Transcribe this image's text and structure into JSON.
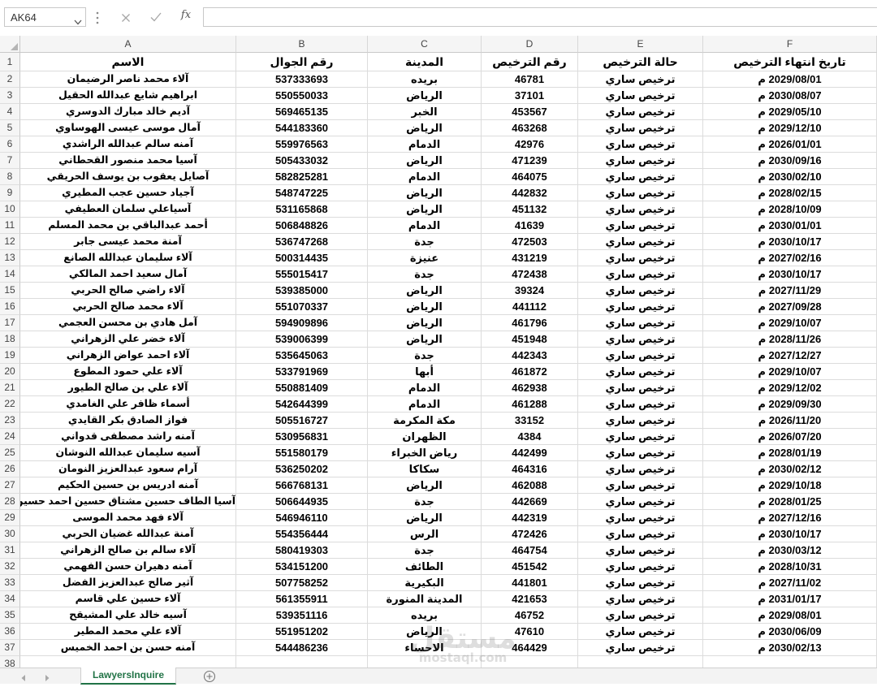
{
  "colors": {
    "accent": "#217346"
  },
  "name_box": {
    "value": "AK64",
    "dropdown_icon": "chevron-down-icon"
  },
  "formula_bar": {
    "grip_icon": "vertical-ellipsis-icon",
    "cancel_icon": "close-icon",
    "enter_icon": "check-icon",
    "function_label": "fx",
    "value": ""
  },
  "sheet": {
    "columns": [
      "A",
      "B",
      "C",
      "D",
      "E",
      "F"
    ],
    "row_numbers": [
      "1",
      "2",
      "3",
      "4",
      "5",
      "6",
      "7",
      "8",
      "9",
      "10",
      "11",
      "12",
      "13",
      "14",
      "15",
      "16",
      "17",
      "18",
      "19",
      "20",
      "21",
      "22",
      "23",
      "24",
      "25",
      "26",
      "27",
      "28",
      "29",
      "30",
      "31",
      "32",
      "33",
      "34",
      "35",
      "36",
      "37",
      "38"
    ],
    "rows": [
      [
        "الاسم",
        "رقم الجوال",
        "المدينة",
        "رقم الترخيص",
        "حالة الترخيص",
        "تاريخ انتهاء الترخيص"
      ],
      [
        "آلاء محمد ناصر الرضيمان",
        "537333693",
        "بريده",
        "46781",
        "ترخيص ساري",
        "2029/08/01 م"
      ],
      [
        "ابراهيم شايع عبدالله الحقيل",
        "550550033",
        "الرياض",
        "37101",
        "ترخيص ساري",
        "2030/08/07 م"
      ],
      [
        "آديم خالد مبارك الدوسري",
        "569465135",
        "الخبر",
        "453567",
        "ترخيص ساري",
        "2029/05/10 م"
      ],
      [
        "آمال موسى عيسى الهوساوي",
        "544183360",
        "الرياض",
        "463268",
        "ترخيص ساري",
        "2029/12/10 م"
      ],
      [
        "آمنه سالم عبدالله الراشدي",
        "559976563",
        "الدمام",
        "42976",
        "ترخيص ساري",
        "2026/01/01 م"
      ],
      [
        "آسيا محمد منصور القحطاني",
        "505433032",
        "الرياض",
        "471239",
        "ترخيص ساري",
        "2030/09/16 م"
      ],
      [
        "آصايل يعقوب بن يوسف الحريقي",
        "582825281",
        "الدمام",
        "464075",
        "ترخيص ساري",
        "2030/02/10 م"
      ],
      [
        "آجياد حسين عجب المطيري",
        "548747225",
        "الرياض",
        "442832",
        "ترخيص ساري",
        "2028/02/15 م"
      ],
      [
        "آسياعلي سلمان العطيفي",
        "531165868",
        "الرياض",
        "451132",
        "ترخيص ساري",
        "2028/10/09 م"
      ],
      [
        "أحمد عبدالباقي بن محمد المسلم",
        "506848826",
        "الدمام",
        "41639",
        "ترخيص ساري",
        "2030/01/01 م"
      ],
      [
        "آمنة محمد عيسى جابر",
        "536747268",
        "جدة",
        "472503",
        "ترخيص ساري",
        "2030/10/17 م"
      ],
      [
        "آلاء سليمان عبدالله الصانع",
        "500314435",
        "عنيزة",
        "431219",
        "ترخيص ساري",
        "2027/02/16 م"
      ],
      [
        "آمال سعيد احمد المالكي",
        "555015417",
        "جدة",
        "472438",
        "ترخيص ساري",
        "2030/10/17 م"
      ],
      [
        "آلاء راضي صالح الحربي",
        "539385000",
        "الرياض",
        "39324",
        "ترخيص ساري",
        "2027/11/29 م"
      ],
      [
        "آلاء محمد صالح الحربي",
        "551070337",
        "الرياض",
        "441112",
        "ترخيص ساري",
        "2027/09/28 م"
      ],
      [
        "آمل هادي بن محسن العجمي",
        "594909896",
        "الرياض",
        "461796",
        "ترخيص ساري",
        "2029/10/07 م"
      ],
      [
        "آلاء خضر علي الزهراني",
        "539006399",
        "الرياض",
        "451948",
        "ترخيص ساري",
        "2028/11/26 م"
      ],
      [
        "آلاء احمد عواض الزهراني",
        "535645063",
        "جدة",
        "442343",
        "ترخيص ساري",
        "2027/12/27 م"
      ],
      [
        "آلاء علي حمود المطوع",
        "533791969",
        "أبها",
        "461872",
        "ترخيص ساري",
        "2029/10/07 م"
      ],
      [
        "آلاء علي بن صالح الطيور",
        "550881409",
        "الدمام",
        "462938",
        "ترخيص ساري",
        "2029/12/02 م"
      ],
      [
        "أسماء ظافر علي الغامدي",
        "542644399",
        "الدمام",
        "461288",
        "ترخيص ساري",
        "2029/09/30 م"
      ],
      [
        "فواز الصادق بكر القايدي",
        "505516727",
        "مكة المكرمة",
        "33152",
        "ترخيص ساري",
        "2026/11/20 م"
      ],
      [
        "آمنه راشد مصطفى قدواني",
        "530956831",
        "الظهران",
        "4384",
        "ترخيص ساري",
        "2026/07/20 م"
      ],
      [
        "آسيه سليمان عبدالله النوشان",
        "551580179",
        "رياض الخبراء",
        "442499",
        "ترخيص ساري",
        "2028/01/19 م"
      ],
      [
        "آرام سعود عبدالعزيز النومان",
        "536250202",
        "سكاكا",
        "464316",
        "ترخيص ساري",
        "2030/02/12 م"
      ],
      [
        "آمنه ادريس بن حسين الحكيم",
        "566768131",
        "الرياض",
        "462088",
        "ترخيص ساري",
        "2029/10/18 م"
      ],
      [
        "آسيا الطاف حسين مشتاق حسين احمد حسين",
        "506644935",
        "جدة",
        "442669",
        "ترخيص ساري",
        "2028/01/25 م"
      ],
      [
        "آلاء فهد محمد الموسى",
        "546946110",
        "الرياض",
        "442319",
        "ترخيص ساري",
        "2027/12/16 م"
      ],
      [
        "آمنة عبدالله غضيان الحربي",
        "554356444",
        "الرس",
        "472426",
        "ترخيص ساري",
        "2030/10/17 م"
      ],
      [
        "آلاء سالم بن صالح الزهراني",
        "580419303",
        "جدة",
        "464754",
        "ترخيص ساري",
        "2030/03/12 م"
      ],
      [
        "آمنه دهيران حسن الفهمي",
        "534151200",
        "الطائف",
        "451542",
        "ترخيص ساري",
        "2028/10/31 م"
      ],
      [
        "آثير صالح عبدالعزيز الفضل",
        "507758252",
        "البكيرية",
        "441801",
        "ترخيص ساري",
        "2027/11/02 م"
      ],
      [
        "آلاء حسين علي قاسم",
        "561355911",
        "المدينة المنورة",
        "421653",
        "ترخيص ساري",
        "2031/01/17 م"
      ],
      [
        "آسيه خالد علي المشيقح",
        "539351116",
        "بريده",
        "46752",
        "ترخيص ساري",
        "2029/08/01 م"
      ],
      [
        "آلاء علي محمد المطير",
        "551951202",
        "الرياض",
        "47610",
        "ترخيص ساري",
        "2030/06/09 م"
      ],
      [
        "آمنه حسن بن احمد الخميس",
        "544486236",
        "الاحساء",
        "464429",
        "ترخيص ساري",
        "2030/02/13 م"
      ]
    ]
  },
  "sheet_tabs": {
    "prev_icon": "triangle-left-icon",
    "next_icon": "triangle-right-icon",
    "tabs": [
      {
        "label": "LawyersInquire",
        "active": true
      }
    ],
    "add_sheet_icon": "plus-circle-icon"
  },
  "watermark": {
    "arabic": "مستقل",
    "latin": "mostaql.com"
  }
}
